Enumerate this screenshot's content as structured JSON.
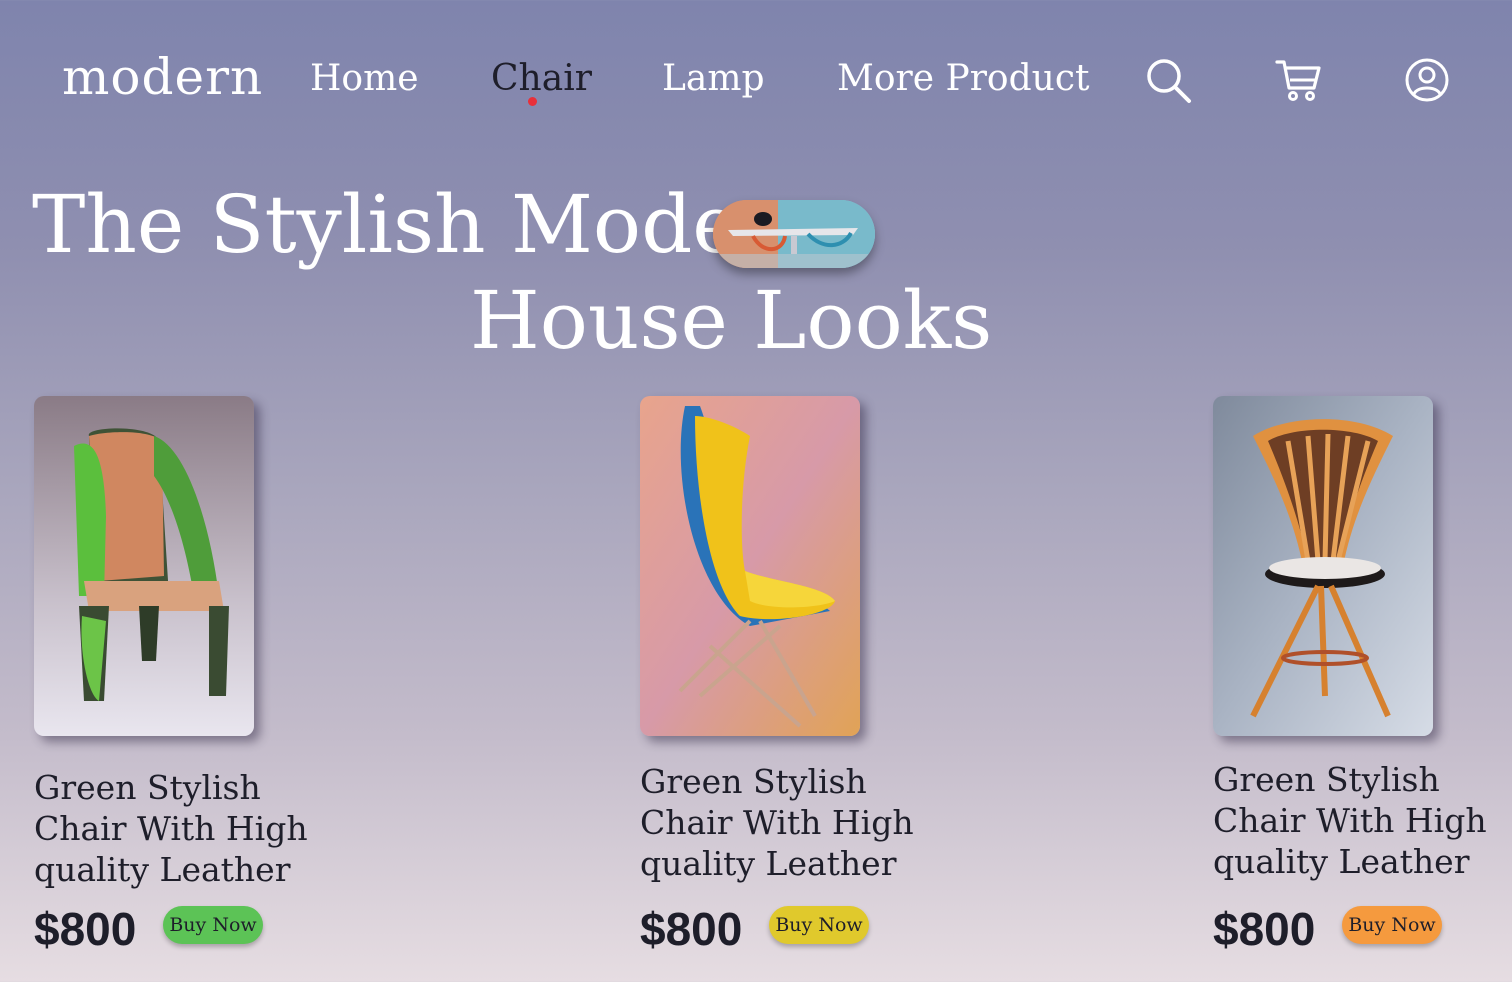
{
  "brand": {
    "logo": "modern"
  },
  "nav": {
    "items": [
      {
        "label": "Home"
      },
      {
        "label": "Chair"
      },
      {
        "label": "Lamp"
      },
      {
        "label": "More Product"
      }
    ],
    "active": "Chair",
    "icons": [
      "search-icon",
      "cart-icon",
      "user-icon"
    ]
  },
  "hero": {
    "line1": "The Stylish Modern",
    "line2": "House Looks"
  },
  "products": [
    {
      "title": "Green Stylish Chair With High quality Leather",
      "price": "$800",
      "button": "Buy Now",
      "button_color": "#5cc356"
    },
    {
      "title": "Green Stylish Chair With High quality Leather",
      "price": "$800",
      "button": "Buy Now",
      "button_color": "#e0c92c"
    },
    {
      "title": "Green Stylish Chair With High quality Leather",
      "price": "$800",
      "button": "Buy Now",
      "button_color": "#f59a3e"
    }
  ],
  "colors": {
    "active_dot": "#e8303a",
    "text_dark": "#1e1e2a"
  }
}
